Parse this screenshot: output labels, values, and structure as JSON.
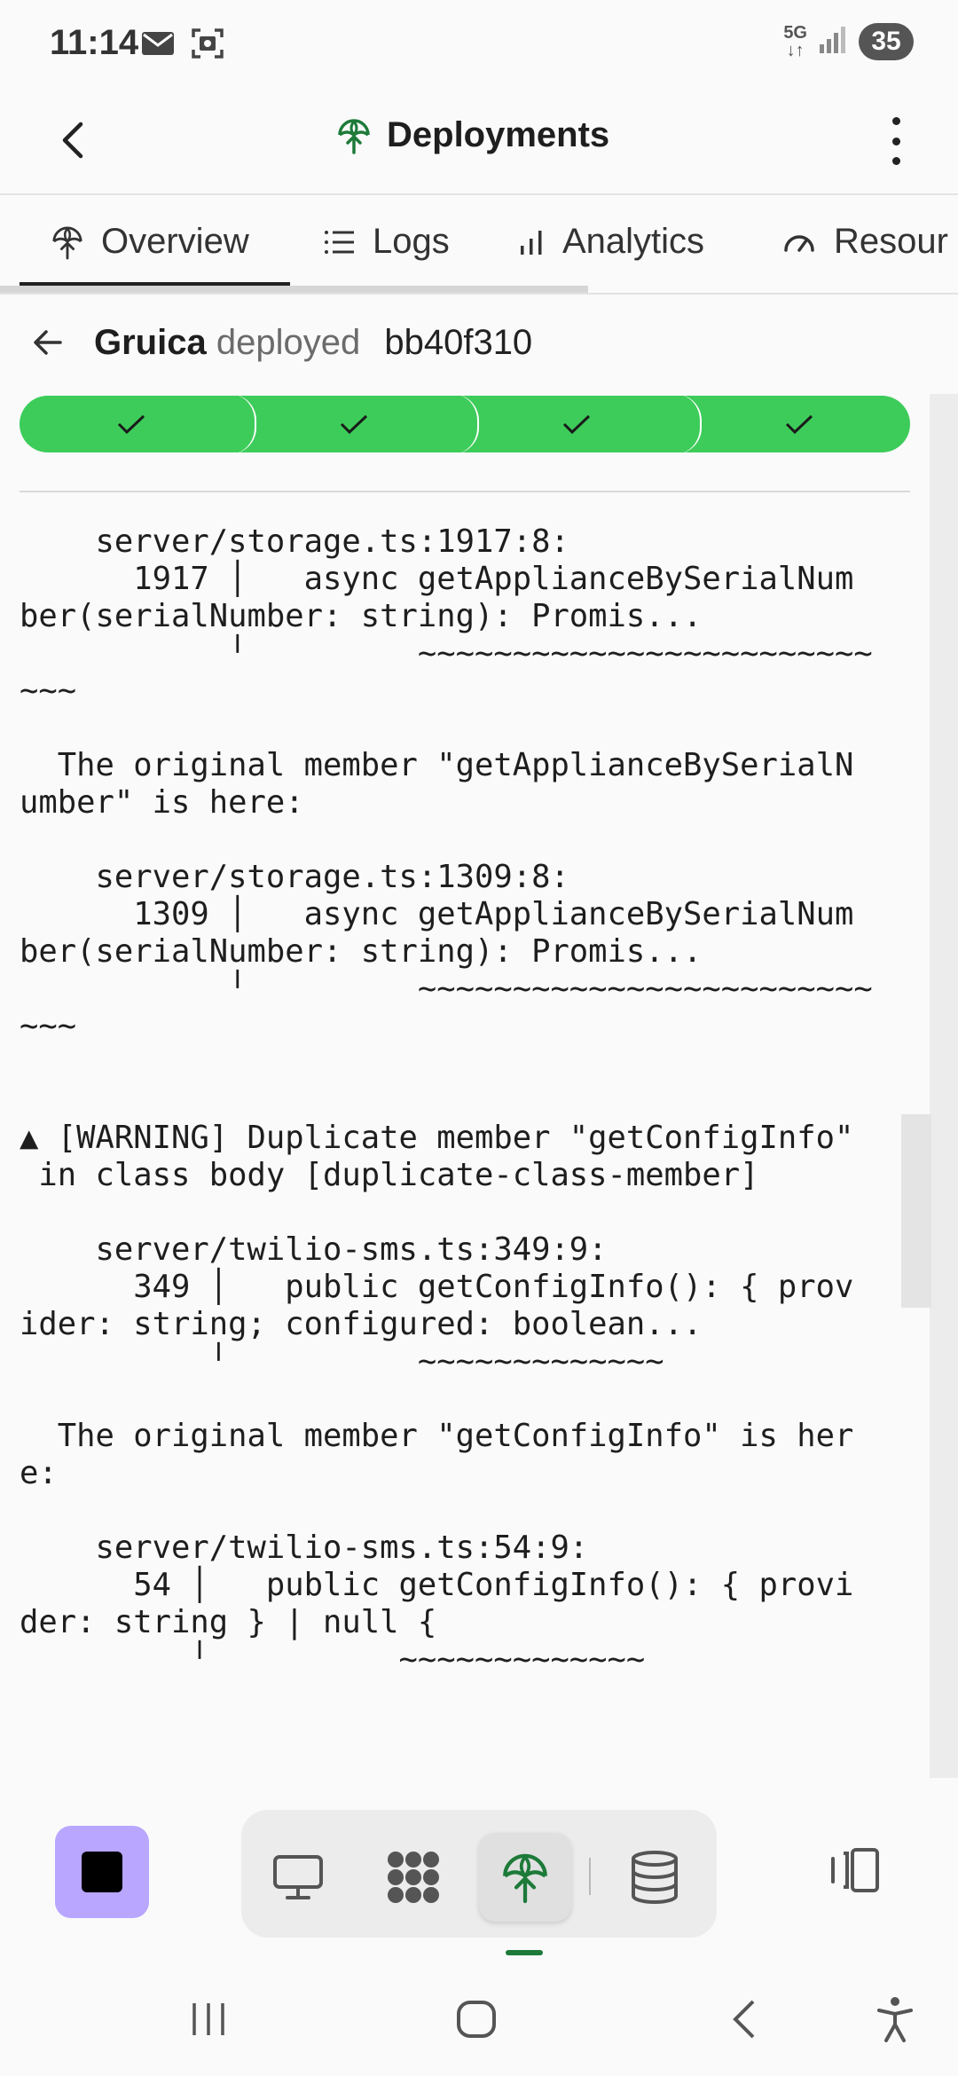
{
  "status_bar": {
    "time": "11:14",
    "network": "5G",
    "battery": "35",
    "icons": [
      "mail-icon",
      "screenshot-icon",
      "signal-icon"
    ]
  },
  "header": {
    "title": "Deployments",
    "icon": "deploy-icon"
  },
  "tabs": [
    {
      "label": "Overview",
      "icon": "deploy-icon",
      "active": true
    },
    {
      "label": "Logs",
      "icon": "list-icon",
      "active": false
    },
    {
      "label": "Analytics",
      "icon": "bar-chart-icon",
      "active": false
    },
    {
      "label": "Resour",
      "icon": "gauge-icon",
      "active": false
    }
  ],
  "deployment": {
    "name": "Gruica",
    "verb": "deployed",
    "hash": "bb40f310",
    "steps_completed": 4,
    "steps_total": 4,
    "accent_color": "#3dcc5a"
  },
  "log": {
    "lines": [
      "    server/storage.ts:1917:8:",
      "      1917 │   async getApplianceBySerialNum",
      "ber(serialNumber: string): Promis...",
      "           ╵         ~~~~~~~~~~~~~~~~~~~~~~~~",
      "~~~",
      "",
      "  The original member \"getApplianceBySerialN",
      "umber\" is here:",
      "",
      "    server/storage.ts:1309:8:",
      "      1309 │   async getApplianceBySerialNum",
      "ber(serialNumber: string): Promis...",
      "           ╵         ~~~~~~~~~~~~~~~~~~~~~~~~",
      "~~~",
      "",
      "",
      "▲ [WARNING] Duplicate member \"getConfigInfo\"",
      " in class body [duplicate-class-member]",
      "",
      "    server/twilio-sms.ts:349:9:",
      "      349 │   public getConfigInfo(): { prov",
      "ider: string; configured: boolean...",
      "          ╵          ~~~~~~~~~~~~~",
      "",
      "  The original member \"getConfigInfo\" is her",
      "e:",
      "",
      "    server/twilio-sms.ts:54:9:",
      "      54 │   public getConfigInfo(): { provi",
      "der: string } | null {",
      "         ╵          ~~~~~~~~~~~~~"
    ]
  },
  "toolbar": {
    "stop_color": "#b8a6ff",
    "tools": [
      {
        "name": "desktop-icon",
        "active": false
      },
      {
        "name": "apps-grid-icon",
        "active": false
      },
      {
        "name": "deploy-icon",
        "active": true
      },
      {
        "name": "database-icon",
        "active": false
      }
    ],
    "panel_icon": "side-panel-icon"
  },
  "nav_bar": {
    "items": [
      "recent-apps-icon",
      "home-icon",
      "back-icon",
      "accessibility-icon"
    ]
  }
}
